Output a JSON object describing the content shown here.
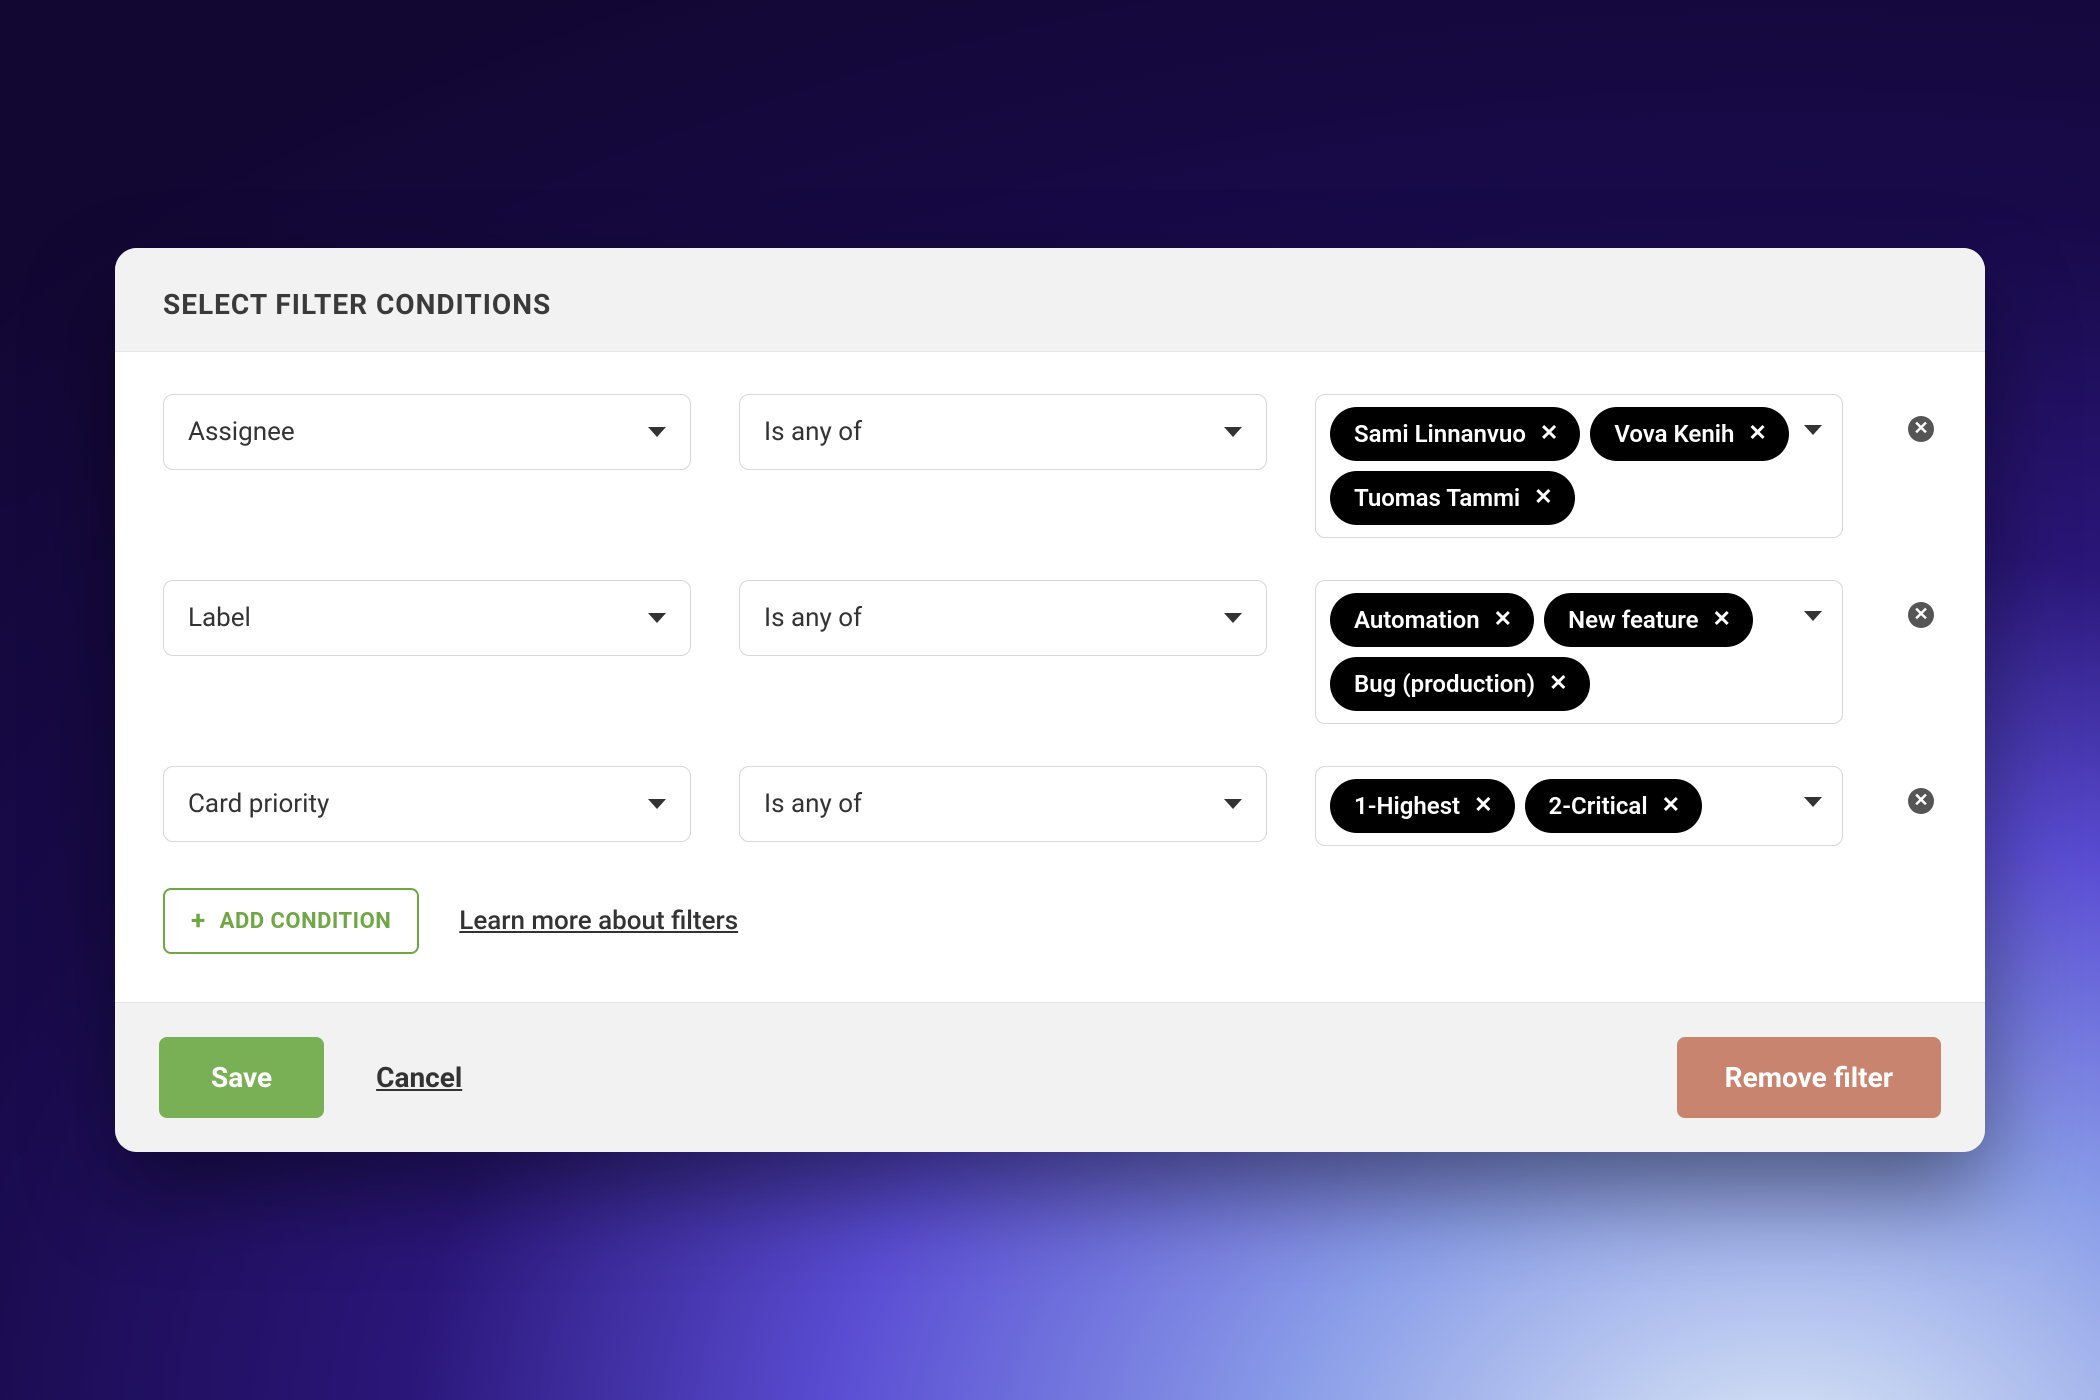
{
  "header": {
    "title": "SELECT FILTER CONDITIONS"
  },
  "conditions": [
    {
      "field": "Assignee",
      "operator": "Is any of",
      "values": [
        "Sami Linnanvuo",
        "Vova Kenih",
        "Tuomas Tammi"
      ]
    },
    {
      "field": "Label",
      "operator": "Is any of",
      "values": [
        "Automation",
        "New feature",
        "Bug (production)"
      ]
    },
    {
      "field": "Card priority",
      "operator": "Is any of",
      "values": [
        "1-Highest",
        "2-Critical"
      ]
    }
  ],
  "actions": {
    "add_condition": "ADD CONDITION",
    "learn_more": "Learn more about filters"
  },
  "footer": {
    "save": "Save",
    "cancel": "Cancel",
    "remove_filter": "Remove filter"
  }
}
